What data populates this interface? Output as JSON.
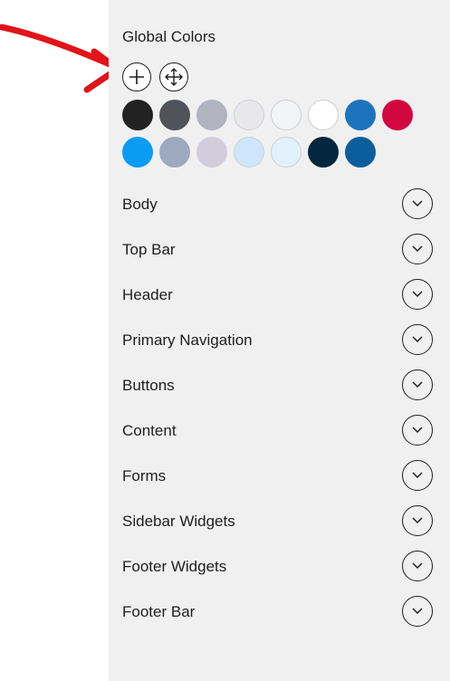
{
  "global_colors": {
    "title": "Global Colors",
    "swatches": [
      "#222222",
      "#50535a",
      "#b1b3bf",
      "#e8e8ea",
      "#f3f4f6",
      "#ffffff",
      "#1e73be",
      "#d3073f",
      "#0a9bf5",
      "#9ca9bf",
      "#d2cddd",
      "#cfe6fa",
      "#e2f2fc",
      "#03273f",
      "#0b5e9c"
    ]
  },
  "sections": [
    "Body",
    "Top Bar",
    "Header",
    "Primary Navigation",
    "Buttons",
    "Content",
    "Forms",
    "Sidebar Widgets",
    "Footer Widgets",
    "Footer Bar"
  ],
  "colors": {
    "annotation_arrow": "#e1141a",
    "panel_bg": "#f0f0f1"
  }
}
